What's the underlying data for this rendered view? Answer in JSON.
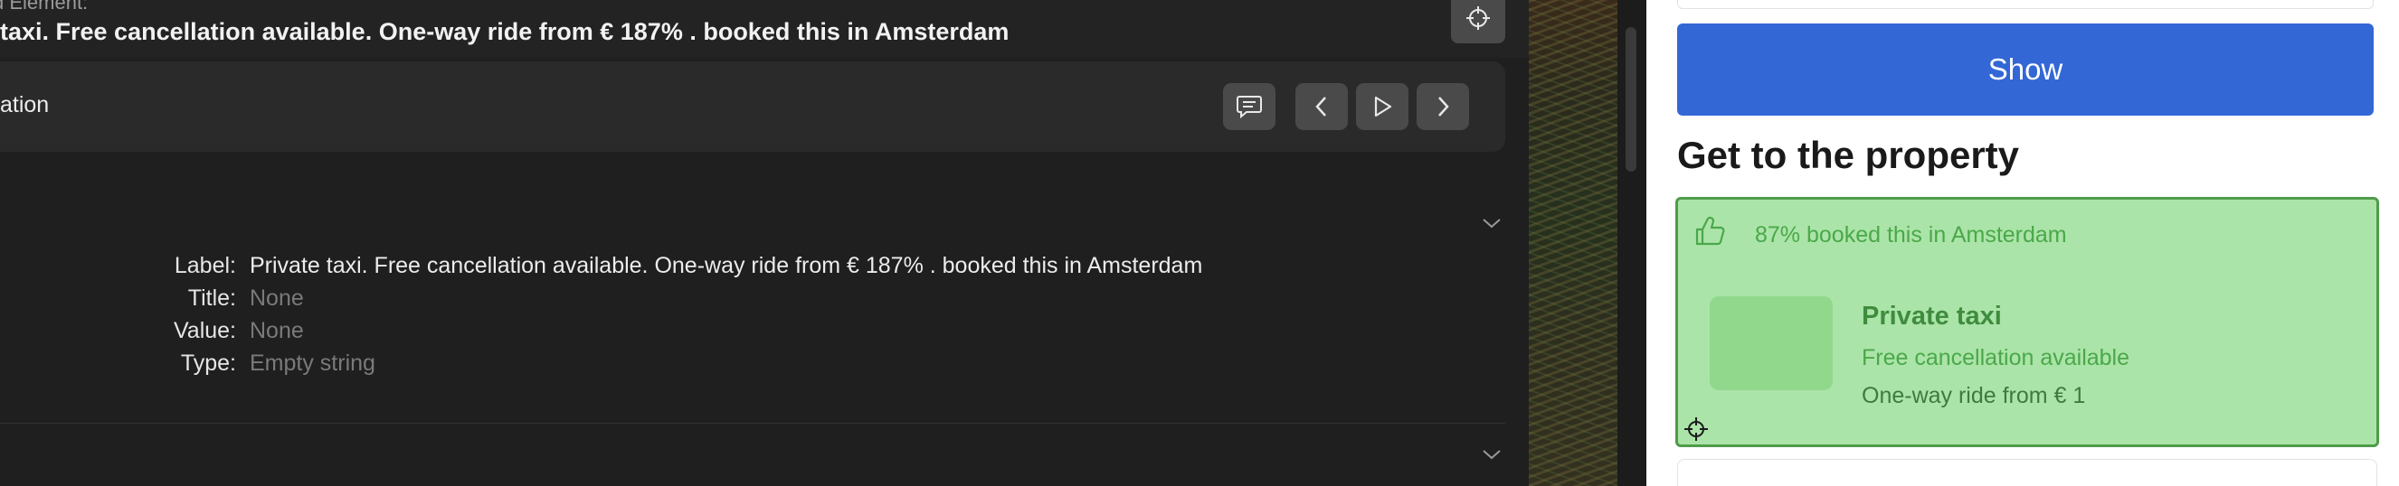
{
  "inspector": {
    "caption": "d Element:",
    "element_title": "taxi. Free cancellation available. One-way ride from € 187% . booked this in Amsterdam",
    "action_label": "ation",
    "properties": [
      {
        "key": "Label:",
        "value": "Private taxi. Free cancellation available. One-way ride from € 187% . booked this in Amsterdam",
        "muted": false
      },
      {
        "key": "Title:",
        "value": "None",
        "muted": true
      },
      {
        "key": "Value:",
        "value": "None",
        "muted": true
      },
      {
        "key": "Type:",
        "value": "Empty string",
        "muted": true
      }
    ],
    "icons": [
      "crosshair-icon",
      "comment-icon",
      "chevron-left-icon",
      "play-icon",
      "chevron-right-icon",
      "chevron-down-icon"
    ]
  },
  "app": {
    "show_button": "Show",
    "section_title": "Get to the property",
    "taxi_card": {
      "booked_text": "87% booked this in Amsterdam",
      "name": "Private taxi",
      "cancellation": "Free cancellation available",
      "price": "One-way ride from € 1"
    },
    "colors": {
      "primary_button": "#3367d6",
      "highlight_overlay": "#66ce60",
      "inspector_bg": "#1f1f1f"
    }
  }
}
